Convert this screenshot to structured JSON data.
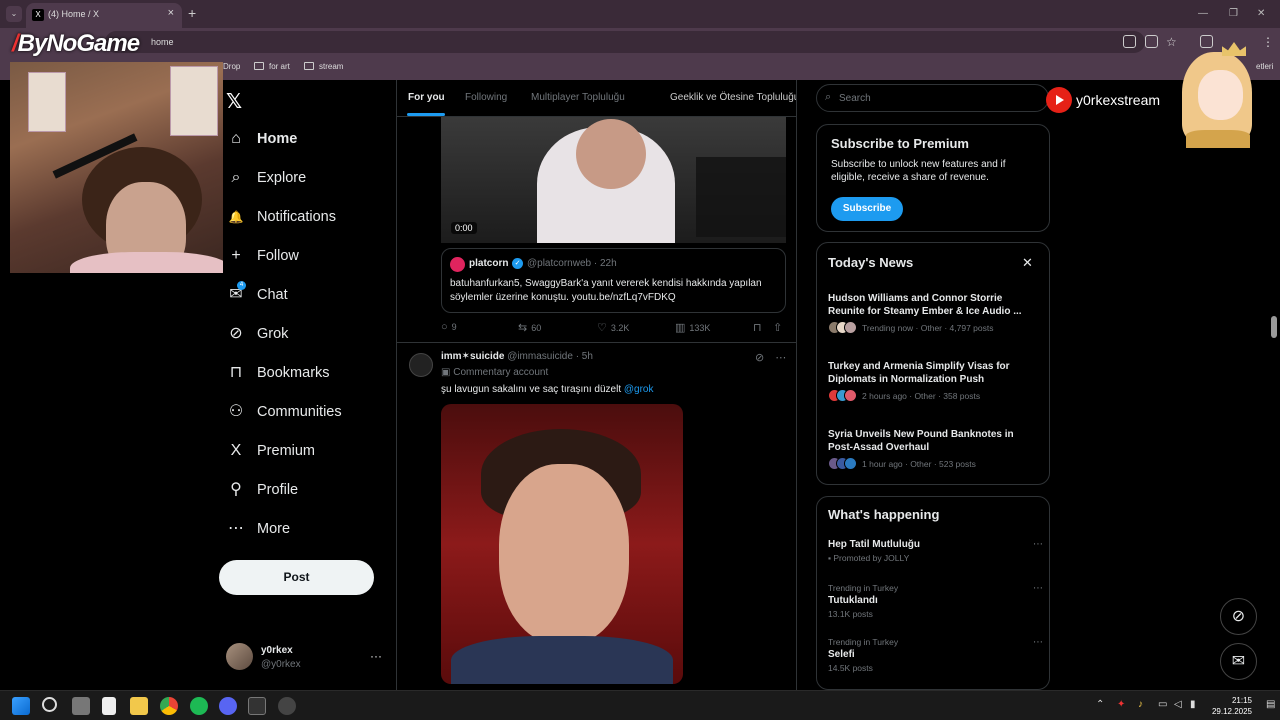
{
  "browser": {
    "tab_title": "(4) Home / X",
    "url": "home",
    "bookmarks": [
      "Drop",
      "for art",
      "stream"
    ],
    "bookmarks_right": "etleri"
  },
  "overlay": {
    "logo": "ByNoGame",
    "youtube_channel": "y0rkexstream"
  },
  "nav": {
    "items": [
      {
        "label": "Home",
        "icon": "home-icon",
        "glyph": "⌂"
      },
      {
        "label": "Explore",
        "icon": "search-icon",
        "glyph": "⌕"
      },
      {
        "label": "Notifications",
        "icon": "bell-icon",
        "glyph": "🔔"
      },
      {
        "label": "Follow",
        "icon": "add-person-icon",
        "glyph": "+"
      },
      {
        "label": "Chat",
        "icon": "mail-icon",
        "glyph": "✉"
      },
      {
        "label": "Grok",
        "icon": "grok-icon",
        "glyph": "⊘"
      },
      {
        "label": "Bookmarks",
        "icon": "bookmark-icon",
        "glyph": "⊓"
      },
      {
        "label": "Communities",
        "icon": "people-icon",
        "glyph": "⚇"
      },
      {
        "label": "Premium",
        "icon": "x-icon",
        "glyph": "X"
      },
      {
        "label": "Profile",
        "icon": "person-icon",
        "glyph": "⚲"
      },
      {
        "label": "More",
        "icon": "more-icon",
        "glyph": "⋯"
      }
    ],
    "chat_badge": "4",
    "post_label": "Post"
  },
  "account": {
    "name": "y0rkex",
    "handle": "@y0rkex",
    "more": "···"
  },
  "feed": {
    "tabs": [
      "For you",
      "Following",
      "Multiplayer Topluluğu",
      "Geeklik ve Ötesine Topluluğu"
    ],
    "tweet1": {
      "video_time": "0:00",
      "quote_name": "platcorn",
      "quote_handle": "@platcornweb · 22h",
      "quote_text": "batuhanfurkan5, SwaggyBark'a yanıt vererek kendisi hakkında yapılan söylemler üzerine konuştu. youtu.be/nzfLq7vFDKQ",
      "replies": "9",
      "reposts": "60",
      "likes": "3.2K",
      "views": "133K"
    },
    "tweet2": {
      "name": "imm✶suicide",
      "handle": "@immasuicide · 5h",
      "label": "Commentary account",
      "text": "şu lavugun sakalını ve saç tıraşını düzelt",
      "mention": "@grok"
    }
  },
  "right": {
    "search_placeholder": "Search",
    "premium": {
      "title": "Subscribe to Premium",
      "desc": "Subscribe to unlock new features and if eligible, receive a share of revenue.",
      "button": "Subscribe"
    },
    "news": {
      "title": "Today's News",
      "items": [
        {
          "headline": "Hudson Williams and Connor Storrie Reunite for Steamy Ember & Ice Audio ...",
          "meta": "Trending now · Other · 4,797 posts"
        },
        {
          "headline": "Turkey and Armenia Simplify Visas for Diplomats in Normalization Push",
          "meta": "2 hours ago · Other · 358 posts"
        },
        {
          "headline": "Syria Unveils New Pound Banknotes in Post-Assad Overhaul",
          "meta": "1 hour ago · Other · 523 posts"
        }
      ]
    },
    "happening": {
      "title": "What's happening",
      "items": [
        {
          "context": "",
          "topic": "Hep Tatil Mutluluğu",
          "meta": "Promoted by JOLLY"
        },
        {
          "context": "Trending in Turkey",
          "topic": "Tutuklandı",
          "meta": "13.1K posts"
        },
        {
          "context": "Trending in Turkey",
          "topic": "Selefi",
          "meta": "14.5K posts"
        }
      ]
    }
  },
  "taskbar": {
    "time": "21:15",
    "date": "29.12.2025"
  },
  "colors": {
    "accent": "#1d9bf0",
    "browser_chrome": "#4e3a4c",
    "background": "#000000"
  }
}
